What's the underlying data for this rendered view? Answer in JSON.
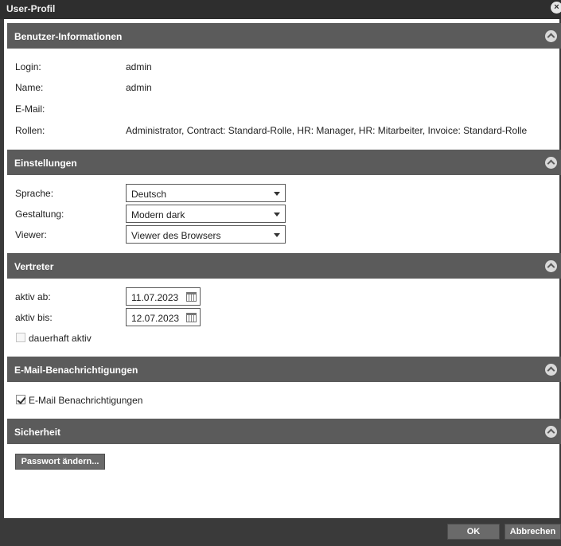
{
  "window": {
    "title": "User-Profil",
    "close_icon": "close-icon"
  },
  "sections": {
    "user_info": {
      "title": "Benutzer-Informationen",
      "login_label": "Login:",
      "login_value": "admin",
      "name_label": "Name:",
      "name_value": "admin",
      "email_label": "E-Mail:",
      "email_value": "",
      "roles_label": "Rollen:",
      "roles_value": "Administrator, Contract: Standard-Rolle, HR: Manager, HR: Mitarbeiter, Invoice: Standard-Rolle"
    },
    "settings": {
      "title": "Einstellungen",
      "language_label": "Sprache:",
      "language_value": "Deutsch",
      "theme_label": "Gestaltung:",
      "theme_value": "Modern dark",
      "viewer_label": "Viewer:",
      "viewer_value": "Viewer des Browsers"
    },
    "substitute": {
      "title": "Vertreter",
      "from_label": "aktiv ab:",
      "from_value": "11.07.2023",
      "to_label": "aktiv bis:",
      "to_value": "12.07.2023",
      "permanent_label": "dauerhaft aktiv",
      "permanent_checked": false
    },
    "notifications": {
      "title": "E-Mail-Benachrichtigungen",
      "email_notify_label": "E-Mail Benachrichtigungen",
      "email_notify_checked": true
    },
    "security": {
      "title": "Sicherheit",
      "change_password_label": "Passwort ändern..."
    }
  },
  "footer": {
    "ok_label": "OK",
    "cancel_label": "Abbrechen"
  },
  "colors": {
    "titlebar": "#2e2e2e",
    "section_header": "#5b5b5b",
    "button": "#6a6a6a"
  }
}
